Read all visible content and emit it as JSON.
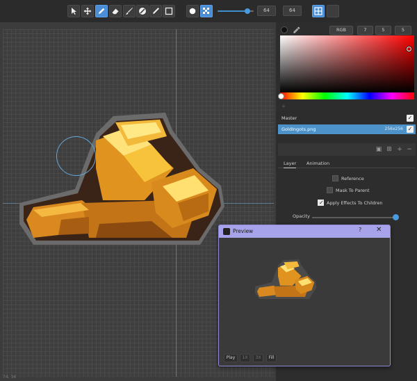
{
  "toolbar": {
    "tools": [
      {
        "name": "select-tool",
        "icon": "arrow-cursor-icon",
        "active": false
      },
      {
        "name": "move-tool",
        "icon": "move-arrows-icon",
        "active": false
      },
      {
        "name": "pencil-tool",
        "icon": "pencil-icon",
        "active": true
      },
      {
        "name": "eraser-tool",
        "icon": "eraser-icon",
        "active": false
      },
      {
        "name": "brush-tool",
        "icon": "brush-icon",
        "active": false
      },
      {
        "name": "fill-tool",
        "icon": "color-wheel-icon",
        "active": false
      },
      {
        "name": "pen-tool",
        "icon": "pen-icon",
        "active": false
      },
      {
        "name": "rect-tool",
        "icon": "rectangle-icon",
        "active": false
      }
    ],
    "brush_shapes": [
      {
        "name": "round-brush",
        "icon": "circle-icon",
        "active": false
      },
      {
        "name": "dither-brush",
        "icon": "dither-icon",
        "active": true
      }
    ],
    "size_slider_fraction": 0.82,
    "width_value": "64",
    "height_value": "64",
    "grid_toggle_icon": "grid-icon"
  },
  "canvas": {
    "status": "74, 34"
  },
  "color_panel": {
    "mode": "RGB",
    "r": "7",
    "g": "5",
    "b": "5",
    "swatch_color": "#111111"
  },
  "layers": {
    "master_label": "Master",
    "layer_name": "GoldIngots.png",
    "layer_size": "256x256",
    "master_visible": true,
    "layer_visible": true
  },
  "properties": {
    "tabs": [
      "Layer",
      "Animation"
    ],
    "reference_label": "Reference",
    "mask_label": "Mask To Parent",
    "apply_effects_label": "Apply Effects To Children",
    "reference_checked": false,
    "mask_checked": false,
    "apply_effects_checked": true,
    "opacity_label": "Opacity",
    "opacity_fraction": 0.98
  },
  "preview": {
    "title": "Preview",
    "help": "?",
    "close": "✕",
    "buttons": [
      "Play",
      "1X",
      "3X",
      "Fill"
    ]
  },
  "colors": {
    "accent": "#4a8ed8",
    "selected_layer": "#4d92c9",
    "preview_title_bar": "#a6a3ea"
  }
}
